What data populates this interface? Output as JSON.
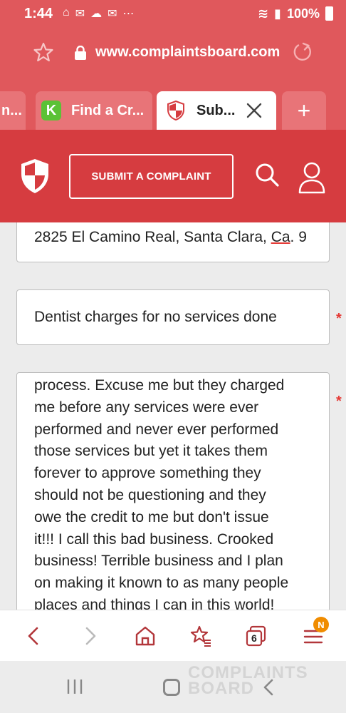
{
  "status_bar": {
    "time": "1:44",
    "battery": "100%",
    "icons": [
      "wifi-icon",
      "signal-icon",
      "battery-icon"
    ]
  },
  "browser": {
    "url": "www.complaintsboard.com",
    "tabs": [
      {
        "label": "n...",
        "active": false
      },
      {
        "label": "Find a Cr...",
        "active": false,
        "favicon": "K"
      },
      {
        "label": "Sub...",
        "active": true
      }
    ],
    "new_tab_label": "+",
    "tab_count": "6",
    "menu_badge": "N"
  },
  "site_header": {
    "submit_button": "SUBMIT A COMPLAINT",
    "accent_color": "#d63c40"
  },
  "form": {
    "address_value_start": "2825 El Camino Real, Santa Clara, ",
    "address_value_ca": "Ca",
    "address_value_end": ". 9",
    "title_value": "Dentist charges for no services done",
    "required_marker": "*",
    "description_lines": [
      "process. Excuse me but they charged",
      "me before any services were ever",
      "performed and never ever performed",
      "those services but yet it takes them",
      "forever to approve something they",
      "should not be questioning and they",
      "owe the credit to me but don't issue",
      "it!!! I call this bad business. Crooked",
      "business! Terrible business and I plan",
      "on making it known to as many people",
      "places and things I can in this world!"
    ]
  },
  "watermark": {
    "line1": "COMPLAINTS",
    "line2": "BOARD"
  }
}
